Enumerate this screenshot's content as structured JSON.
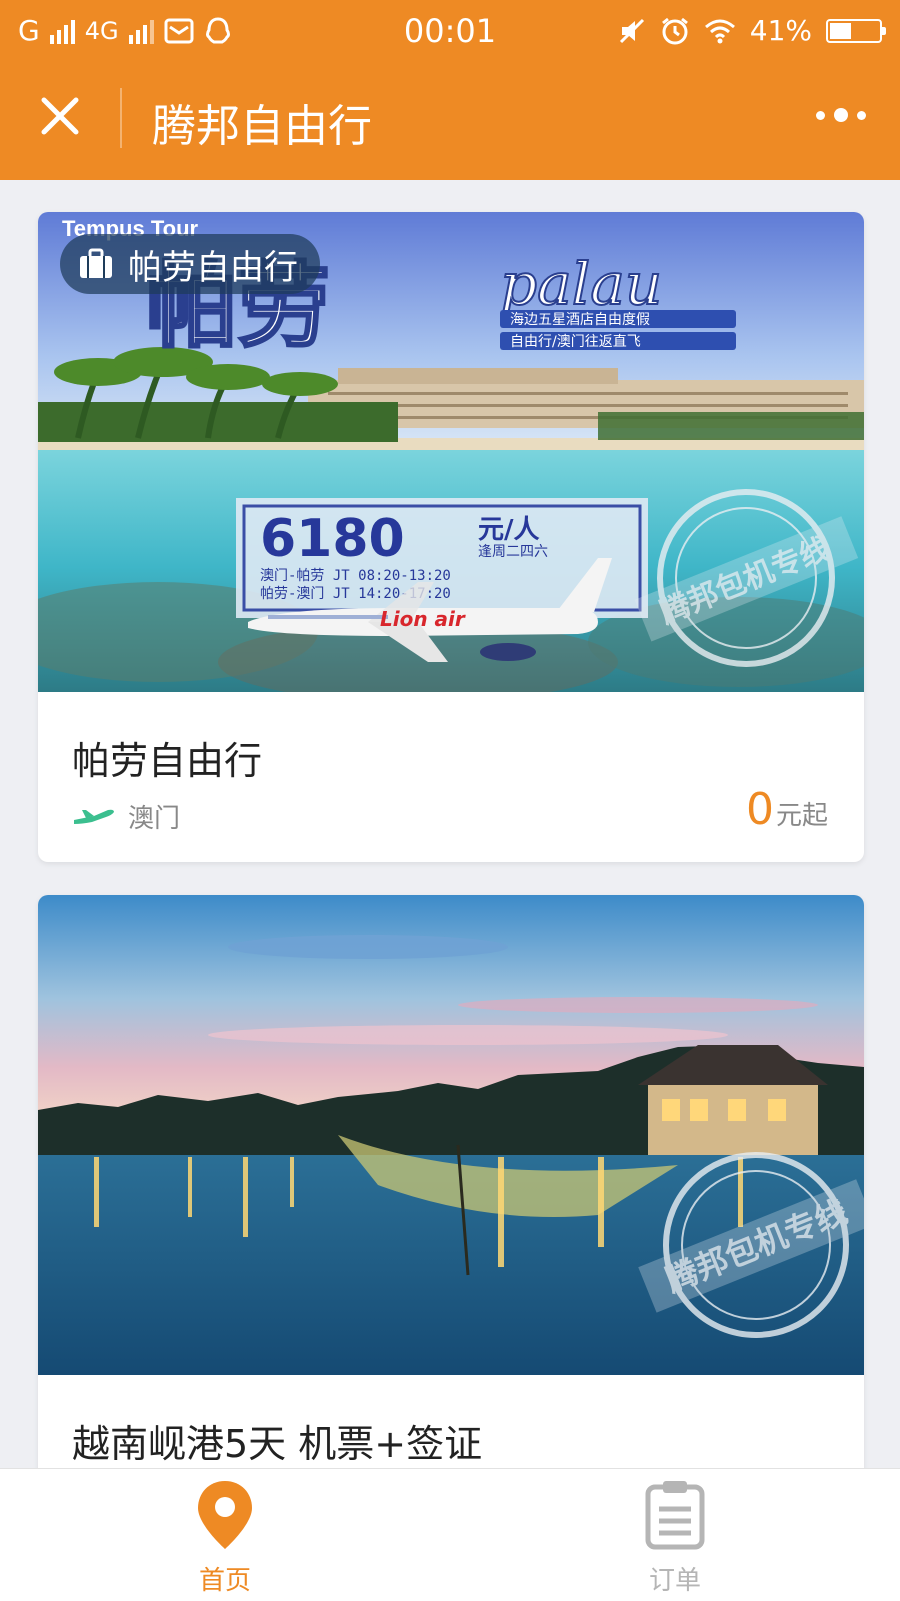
{
  "status_bar": {
    "carrier": "G",
    "network": "4G",
    "time": "00:01",
    "battery": "41%"
  },
  "titlebar": {
    "title": "腾邦自由行"
  },
  "cards": [
    {
      "badge": "帕劳自由行",
      "title": "帕劳自由行",
      "departure": "澳门",
      "price": "0",
      "price_suffix": "元起",
      "banner": {
        "brand": "Tempus Tour",
        "headline_cn": "帕劳",
        "headline_en": "palau",
        "sub1": "海边五星酒店自由度假",
        "sub2": "自由行/澳门往返直飞",
        "price": "6180",
        "price_unit": "元/人",
        "schedule_days": "逢周二四六",
        "flight1": "澳门-帕劳 JT 08:20-13:20",
        "flight2": "帕劳-澳门 JT 14:20-17:20",
        "airline": "Lion air",
        "stamp": "腾邦包机专线"
      }
    },
    {
      "title": "越南岘港5天 机票+签证",
      "banner": {
        "stamp": "腾邦包机专线"
      }
    }
  ],
  "tabbar": {
    "home": "首页",
    "orders": "订单"
  },
  "colors": {
    "accent": "#ee8a24",
    "muted": "#b5b5b5",
    "plane_icon": "#3bbf8f"
  }
}
